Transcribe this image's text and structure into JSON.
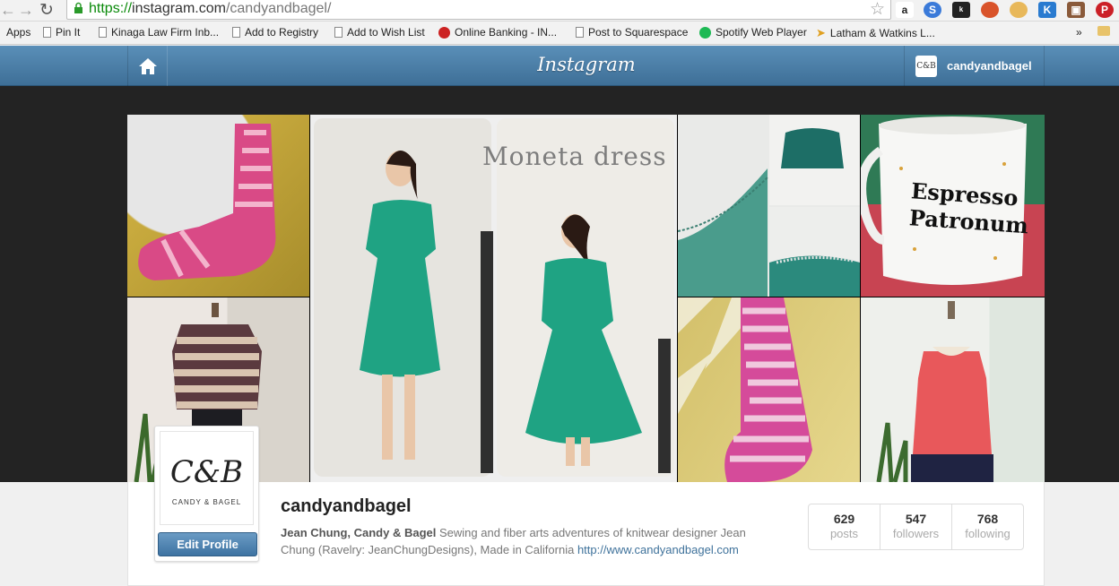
{
  "browser": {
    "url_scheme": "https://",
    "url_host": "instagram.com",
    "url_path": "/candyandbagel/",
    "bookmarks": [
      {
        "label": "Apps"
      },
      {
        "label": "Pin It"
      },
      {
        "label": "Kinaga Law Firm Inb..."
      },
      {
        "label": "Add to Registry"
      },
      {
        "label": "Add to Wish List"
      },
      {
        "label": "Online Banking - IN..."
      },
      {
        "label": "Post to Squarespace"
      },
      {
        "label": "Spotify Web Player"
      },
      {
        "label": "Latham & Watkins L..."
      }
    ],
    "overflow": "»"
  },
  "header": {
    "brand": "Instagram",
    "user_avatar": "C&B",
    "user_name": "candyandbagel"
  },
  "mosaic": {
    "dress_caption": "Moneta dress",
    "mug_text": "Espresso Patronum"
  },
  "profile": {
    "avatar_monogram": "C&B",
    "avatar_caption": "CANDY & BAGEL",
    "edit_label": "Edit Profile",
    "username": "candyandbagel",
    "bio_name": "Jean Chung, Candy & Bagel",
    "bio_text": " Sewing and fiber arts adventures of knitwear designer Jean Chung (Ravelry: JeanChungDesigns), Made in California ",
    "bio_link": "http://www.candyandbagel.com",
    "stats": [
      {
        "num": "629",
        "label": "posts"
      },
      {
        "num": "547",
        "label": "followers"
      },
      {
        "num": "768",
        "label": "following"
      }
    ]
  },
  "colors": {
    "header": "#4a7ea8",
    "link": "#3f729b",
    "accent_teal": "#1fa383"
  }
}
